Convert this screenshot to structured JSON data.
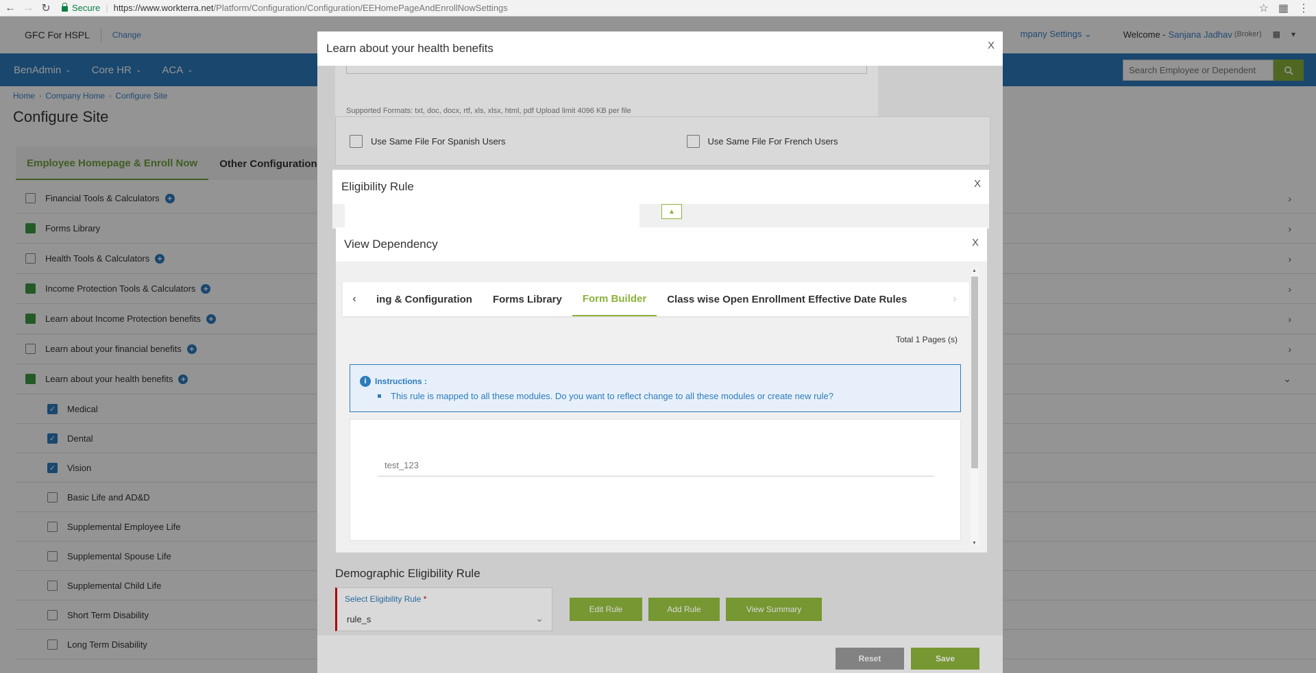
{
  "browser": {
    "secure_label": "Secure",
    "url_host": "https://www.workterra.net",
    "url_path": "/Platform/Configuration/Configuration/EEHomePageAndEnrollNowSettings"
  },
  "header": {
    "company": "GFC For HSPL",
    "change_label": "Change",
    "company_settings": "mpany Settings",
    "welcome": "Welcome -",
    "user_name": "Sanjana Jadhav",
    "role": "(Broker)"
  },
  "nav": {
    "items": [
      "BenAdmin",
      "Core HR",
      "ACA"
    ],
    "search_placeholder": "Search Employee or Dependent"
  },
  "breadcrumb": [
    "Home",
    "Company Home",
    "Configure Site"
  ],
  "page_title": "Configure Site",
  "tabs": [
    "Employee Homepage & Enroll Now",
    "Other Configuration"
  ],
  "list": [
    {
      "label": "Financial Tools & Calculators",
      "state": "unchecked",
      "plus": true
    },
    {
      "label": "Forms Library",
      "state": "filled",
      "plus": false
    },
    {
      "label": "Health Tools & Calculators",
      "state": "unchecked",
      "plus": true
    },
    {
      "label": "Income Protection Tools & Calculators",
      "state": "filled",
      "plus": true
    },
    {
      "label": "Learn about Income Protection benefits",
      "state": "filled",
      "plus": true
    },
    {
      "label": "Learn about your financial benefits",
      "state": "unchecked",
      "plus": true
    },
    {
      "label": "Learn about your health benefits",
      "state": "filled",
      "plus": true
    }
  ],
  "sublist": [
    {
      "label": "Medical",
      "checked": true
    },
    {
      "label": "Dental",
      "checked": true
    },
    {
      "label": "Vision",
      "checked": true
    },
    {
      "label": "Basic Life and AD&D",
      "checked": false
    },
    {
      "label": "Supplemental Employee Life",
      "checked": false
    },
    {
      "label": "Supplemental Spouse Life",
      "checked": false
    },
    {
      "label": "Supplemental Child Life",
      "checked": false
    },
    {
      "label": "Short Term Disability",
      "checked": false
    },
    {
      "label": "Long Term Disability",
      "checked": false
    }
  ],
  "modal1": {
    "title": "Learn about your health benefits",
    "close": "X",
    "supported_formats": "Supported Formats: txt, doc, docx, rtf, xls, xlsx, html, pdf Upload limit 4096 KB per file",
    "spanish_label": "Use Same File For Spanish Users",
    "french_label": "Use Same File For French Users",
    "demographic_title": "Demographic Eligibility Rule",
    "select_label": "Select Eligibility Rule",
    "required_mark": "*",
    "select_value": "rule_s",
    "edit_rule": "Edit Rule",
    "add_rule": "Add Rule",
    "view_summary": "View Summary",
    "reset": "Reset",
    "save": "Save"
  },
  "modal2": {
    "title": "Eligibility Rule",
    "close": "X"
  },
  "modal3": {
    "title": "View Dependency",
    "close": "X",
    "tabs": [
      "ing & Configuration",
      "Forms Library",
      "Form Builder",
      "Class wise Open Enrollment Effective Date Rules"
    ],
    "active_tab": 2,
    "total_pages": "Total 1 Pages (s)",
    "instructions_title": "Instructions :",
    "instructions_text": "This rule is mapped to all these modules. Do you want to reflect change to all these modules or create new rule?",
    "rule_name": "test_123"
  },
  "colors": {
    "brand_blue": "#2c7bbd",
    "accent_green": "#8bb23a",
    "check_green": "#3f9b44"
  }
}
